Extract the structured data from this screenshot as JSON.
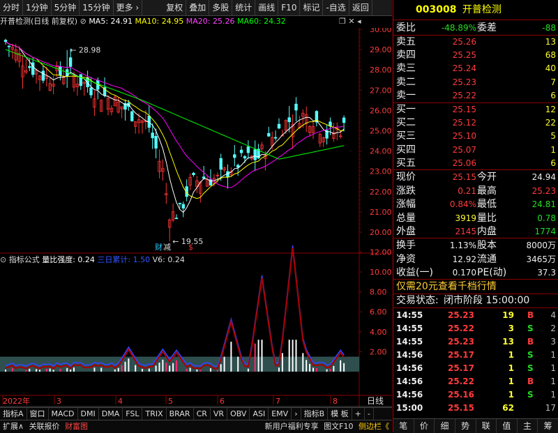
{
  "toolbar": {
    "items": [
      "分时",
      "1分钟",
      "5分钟",
      "15分钟",
      "更多 ›",
      "复权",
      "叠加",
      "多股",
      "统计",
      "画线",
      "F10",
      "标记",
      "-自选",
      "返回"
    ]
  },
  "chart": {
    "title": "开普检测(日线 前复权)",
    "ma5_label": "MA5: 24.91",
    "ma10_label": "MA10: 24.95",
    "ma20_label": "MA20: 25.26",
    "ma60_label": "MA60: 24.32",
    "high_marker": "28.98",
    "low_marker": "19.55",
    "event1": "财",
    "event2": "减",
    "event3": "$",
    "price_axis": [
      "30.00",
      "29.00",
      "28.00",
      "27.00",
      "26.00",
      "25.00",
      "24.00",
      "23.00",
      "22.00",
      "21.00",
      "20.00"
    ],
    "colors": {
      "ma5": "#ffffff",
      "ma10": "#ffff00",
      "ma20": "#ff00ff",
      "ma60": "#00ff00",
      "up": "#ff3333",
      "down": "#54ffff"
    }
  },
  "indicator": {
    "name": "指标公式",
    "label": "量比强度: 0.24",
    "label2": "三日累计: 1.50",
    "label3": "V6: 0.24",
    "axis": [
      "12.00",
      "10.00",
      "8.00",
      "6.00",
      "4.00",
      "2.00"
    ]
  },
  "time_axis": {
    "labels": [
      "2022年",
      "3",
      "4",
      "5",
      "6",
      "7",
      "8"
    ],
    "period": "日线"
  },
  "bottom_tabs": [
    "指标A",
    "窗口",
    "MACD",
    "DMI",
    "DMA",
    "FSL",
    "TRIX",
    "BRAR",
    "CR",
    "VR",
    "OBV",
    "ASI",
    "EMV",
    "›",
    "指标B",
    "模 板",
    "+",
    "-"
  ],
  "status_bar": {
    "left": [
      "扩展∧",
      "关联报价",
      "财富图"
    ],
    "right": [
      "新用户福利专享",
      "图文F10",
      "侧边栏《"
    ]
  },
  "stock": {
    "code": "003008",
    "name": "开普检测",
    "weibi_label": "委比",
    "weibi": "-48.89%",
    "weicha_label": "委差",
    "weicha": "-88",
    "asks": [
      {
        "label": "卖五",
        "price": "25.26",
        "vol": "13"
      },
      {
        "label": "卖四",
        "price": "25.25",
        "vol": "68"
      },
      {
        "label": "卖三",
        "price": "25.24",
        "vol": "40"
      },
      {
        "label": "卖二",
        "price": "25.23",
        "vol": "7"
      },
      {
        "label": "卖一",
        "price": "25.22",
        "vol": "6"
      }
    ],
    "bids": [
      {
        "label": "买一",
        "price": "25.15",
        "vol": "12"
      },
      {
        "label": "买二",
        "price": "25.12",
        "vol": "22"
      },
      {
        "label": "买三",
        "price": "25.10",
        "vol": "5"
      },
      {
        "label": "买四",
        "price": "25.07",
        "vol": "1"
      },
      {
        "label": "买五",
        "price": "25.06",
        "vol": "6"
      }
    ],
    "quote": [
      {
        "l1": "现价",
        "v1": "25.15",
        "c1": "red",
        "l2": "今开",
        "v2": "24.94",
        "c2": "white"
      },
      {
        "l1": "涨跌",
        "v1": "0.21",
        "c1": "red",
        "l2": "最高",
        "v2": "25.23",
        "c2": "red"
      },
      {
        "l1": "涨幅",
        "v1": "0.84%",
        "c1": "red",
        "l2": "最低",
        "v2": "24.81",
        "c2": "green"
      },
      {
        "l1": "总量",
        "v1": "3919",
        "c1": "yellow",
        "l2": "量比",
        "v2": "0.78",
        "c2": "green"
      },
      {
        "l1": "外盘",
        "v1": "2145",
        "c1": "red",
        "l2": "内盘",
        "v2": "1774",
        "c2": "green"
      }
    ],
    "fund": [
      {
        "l1": "换手",
        "v1": "1.13%",
        "l2": "股本",
        "v2": "8000万"
      },
      {
        "l1": "净资",
        "v1": "12.92",
        "l2": "流通",
        "v2": "3465万"
      },
      {
        "l1": "收益(一)",
        "v1": "0.170",
        "l2": "PE(动)",
        "v2": "37.3"
      }
    ],
    "promo": "仅需20元查看千档行情",
    "trade_status_label": "交易状态:",
    "trade_status": "闭市阶段 15:00:00",
    "ticks": [
      {
        "t": "14:55",
        "p": "25.23",
        "v": "19",
        "d": "B",
        "n": "4",
        "pc": "red",
        "dc": "red"
      },
      {
        "t": "14:55",
        "p": "25.22",
        "v": "3",
        "d": "S",
        "n": "2",
        "pc": "red",
        "dc": "green"
      },
      {
        "t": "14:55",
        "p": "25.23",
        "v": "13",
        "d": "B",
        "n": "3",
        "pc": "red",
        "dc": "red"
      },
      {
        "t": "14:56",
        "p": "25.17",
        "v": "1",
        "d": "S",
        "n": "1",
        "pc": "red",
        "dc": "green"
      },
      {
        "t": "14:56",
        "p": "25.17",
        "v": "1",
        "d": "S",
        "n": "1",
        "pc": "red",
        "dc": "green"
      },
      {
        "t": "14:56",
        "p": "25.22",
        "v": "1",
        "d": "B",
        "n": "1",
        "pc": "red",
        "dc": "red"
      },
      {
        "t": "14:56",
        "p": "25.16",
        "v": "1",
        "d": "S",
        "n": "1",
        "pc": "red",
        "dc": "green"
      },
      {
        "t": "15:00",
        "p": "25.15",
        "v": "62",
        "d": "",
        "n": "17",
        "pc": "red",
        "dc": "red"
      }
    ],
    "tabs": [
      "笔",
      "价",
      "细",
      "势",
      "联",
      "值",
      "主",
      "筹"
    ]
  }
}
